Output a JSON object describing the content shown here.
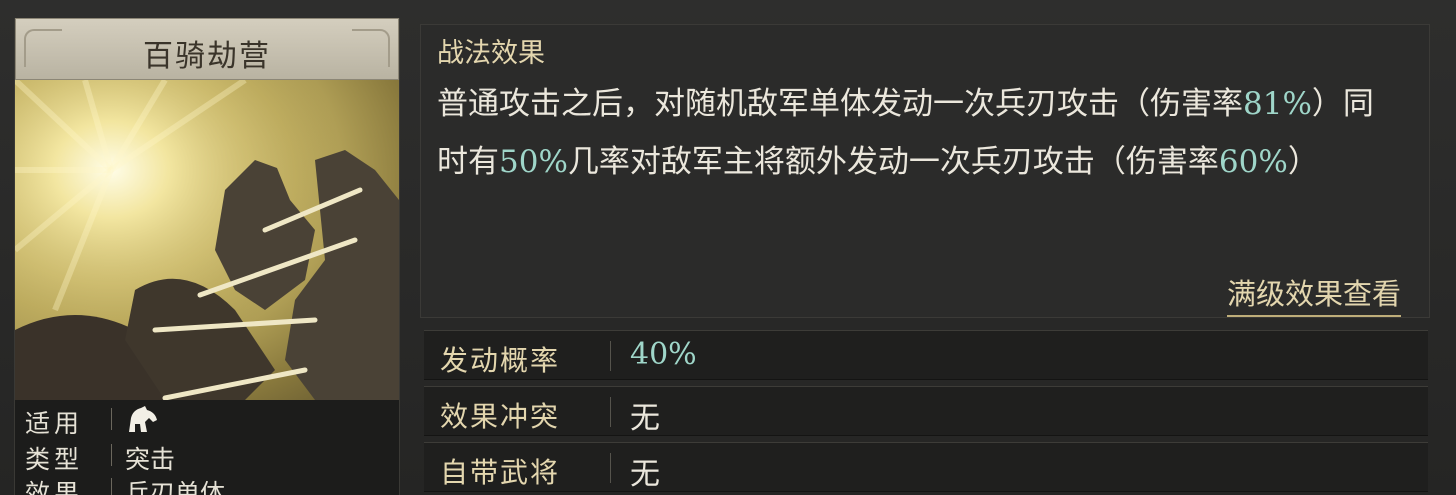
{
  "skill": {
    "name": "百骑劫营",
    "info": {
      "applicable": {
        "label": "适用",
        "icon": "horse-cavalry-icon"
      },
      "type": {
        "label": "类型",
        "value": "突击"
      },
      "effect": {
        "label": "效果",
        "value": "兵刃单体"
      }
    }
  },
  "effect_panel": {
    "heading": "战法效果",
    "desc": {
      "p1": "普通攻击之后，对随机敌军单体发动一次兵刃攻击（伤害率",
      "v1": "81%",
      "p2": "）同时有",
      "v2": "50%",
      "p3": "几率对敌军主将额外发动一次兵刃攻击（伤害率",
      "v3": "60%",
      "p4": "）"
    },
    "view_max_label": "满级效果查看"
  },
  "attributes": [
    {
      "label": "发动概率",
      "value": "40%"
    },
    {
      "label": "效果冲突",
      "value": "无"
    },
    {
      "label": "自带武将",
      "value": "无"
    }
  ],
  "colors": {
    "accent_text": "#e3d6ae",
    "highlight_value": "#9fd6c9",
    "panel_bg": "#2b2b2a"
  }
}
